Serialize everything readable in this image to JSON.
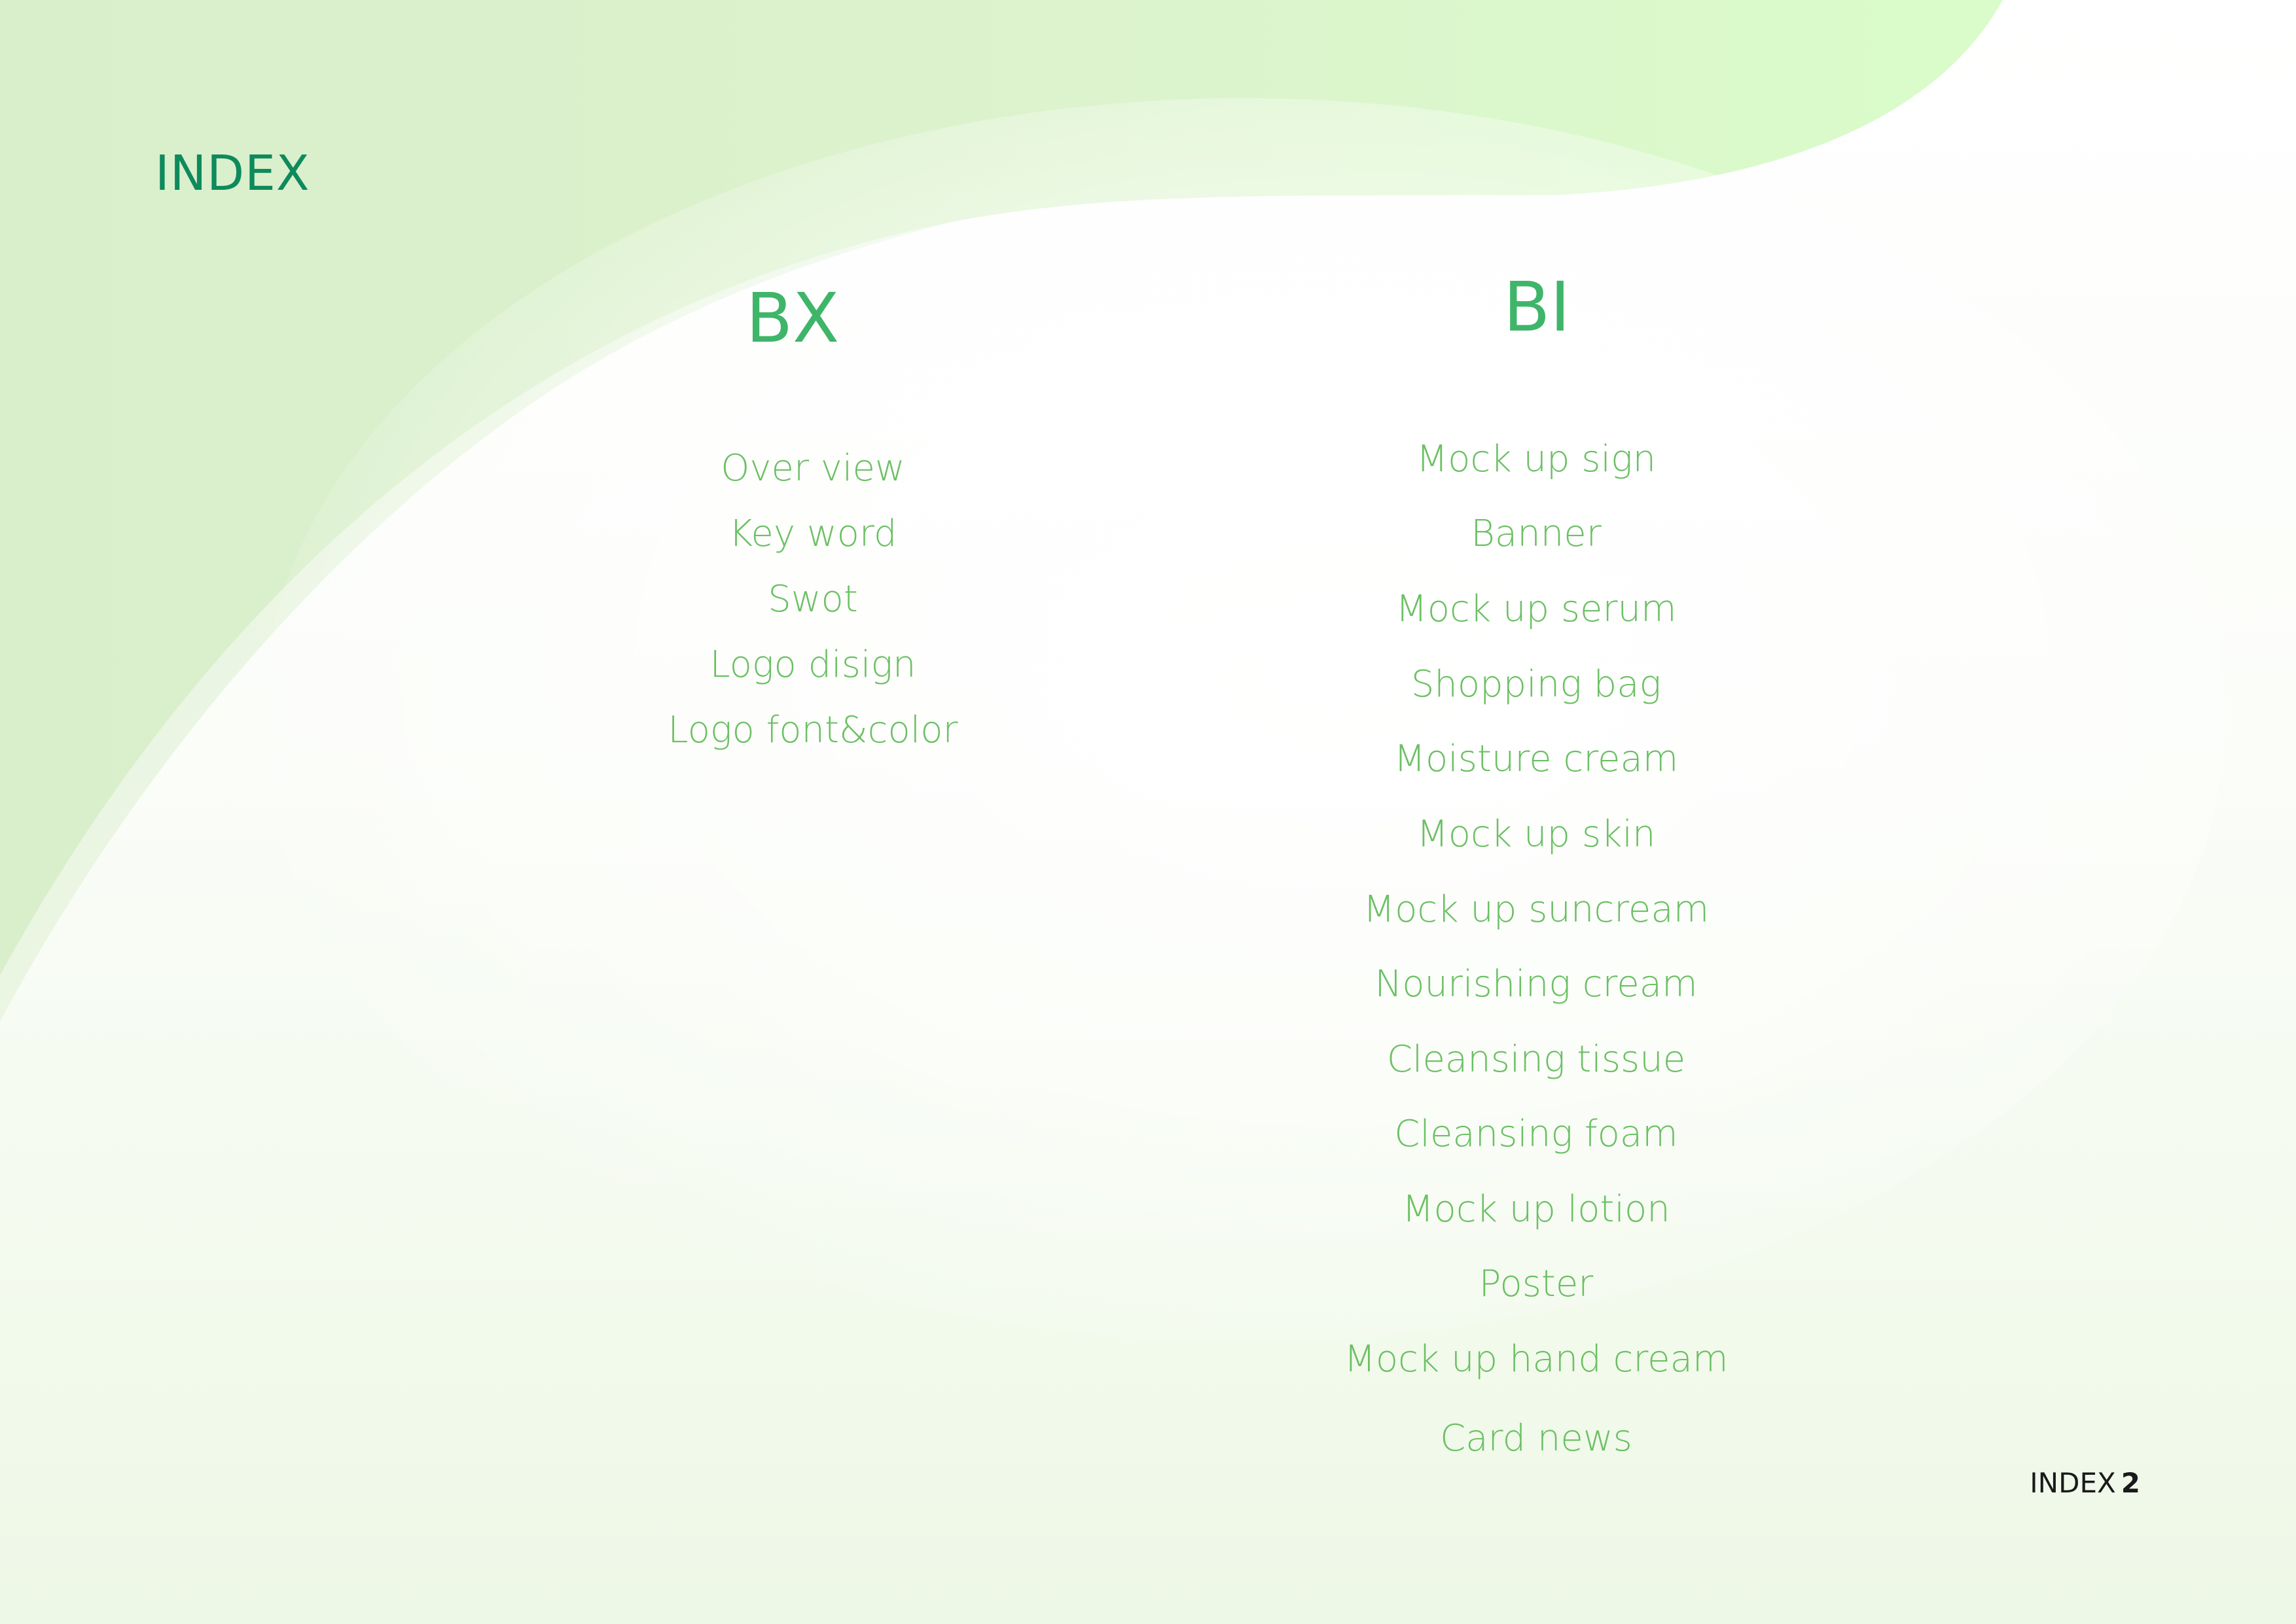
{
  "index_title": "INDEX",
  "bx": {
    "heading": "BX",
    "items": [
      "Over view",
      "Key word",
      "Swot",
      "Logo disign",
      "Logo font&color"
    ]
  },
  "bi": {
    "heading": "BI",
    "items": [
      "Mock up sign",
      "Banner",
      "Mock up serum",
      "Shopping bag",
      "Moisture cream",
      "Mock up skin",
      "Mock up suncream",
      "Nourishing cream",
      "Cleansing tissue",
      "Cleansing foam",
      "Mock up lotion",
      "Poster",
      "Mock up hand cream",
      "Card news"
    ]
  },
  "footer": {
    "label": "INDEX",
    "page_number": "2"
  },
  "colors": {
    "title": "#0e8a5c",
    "heading": "#3fb56a",
    "item": "#6cc064",
    "wave_light": "#dcefcf",
    "wave_bright": "#dafcca"
  }
}
